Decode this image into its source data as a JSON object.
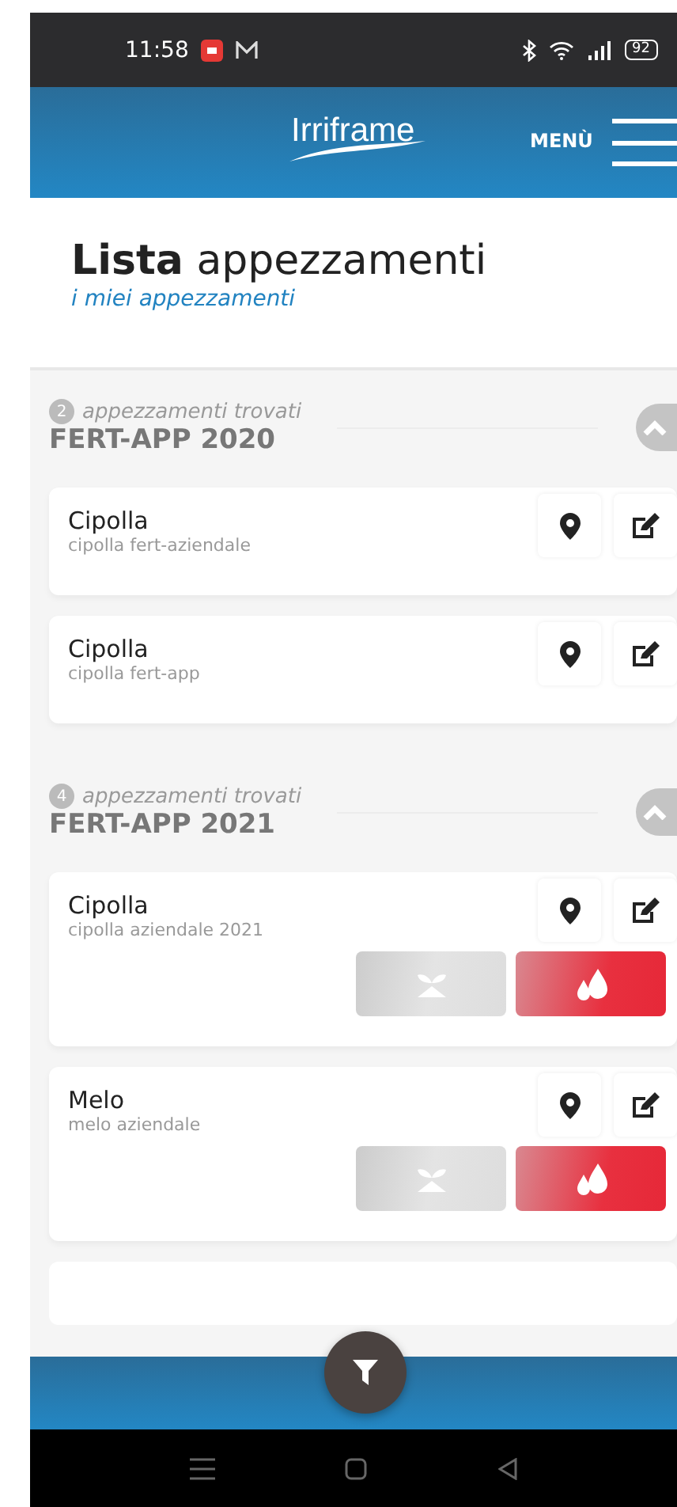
{
  "status_bar": {
    "time": "11:58",
    "battery": "92"
  },
  "header": {
    "logo": "Irriframe",
    "menu_label": "MENÙ"
  },
  "page": {
    "title_bold": "Lista",
    "title_rest": "appezzamenti",
    "subtitle": "i miei appezzamenti"
  },
  "groups": [
    {
      "count": "2",
      "found_label": "appezzamenti trovati",
      "title": "FERT-APP 2020",
      "expanded": true,
      "fields": [
        {
          "name": "Cipolla",
          "description": "cipolla fert-aziendale",
          "has_services": false
        },
        {
          "name": "Cipolla",
          "description": "cipolla fert-app",
          "has_services": false
        }
      ]
    },
    {
      "count": "4",
      "found_label": "appezzamenti trovati",
      "title": "FERT-APP 2021",
      "expanded": true,
      "fields": [
        {
          "name": "Cipolla",
          "description": "cipolla aziendale 2021",
          "has_services": true
        },
        {
          "name": "Melo",
          "description": "melo aziendale",
          "has_services": true
        }
      ],
      "more_below": true
    }
  ]
}
